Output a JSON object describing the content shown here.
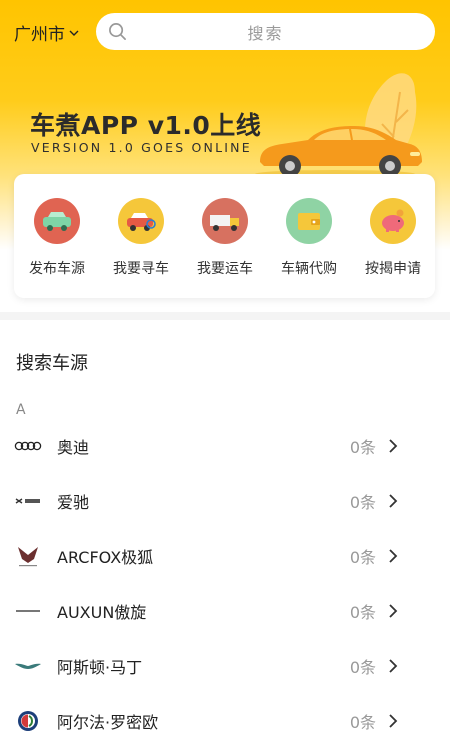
{
  "header": {
    "city": "广州市",
    "search_placeholder": "搜索"
  },
  "banner": {
    "title": "车煮APP v1.0上线",
    "subtitle": "VERSION 1.0 GOES ONLINE"
  },
  "services": [
    {
      "label": "发布车源",
      "icon": "car-icon",
      "color": "#e06452"
    },
    {
      "label": "我要寻车",
      "icon": "car-search-icon",
      "color": "#f5c73a"
    },
    {
      "label": "我要运车",
      "icon": "truck-icon",
      "color": "#d77160"
    },
    {
      "label": "车辆代购",
      "icon": "wallet-icon",
      "color": "#8fd3a4"
    },
    {
      "label": "按揭申请",
      "icon": "piggy-bank-icon",
      "color": "#f5c73a"
    }
  ],
  "brands_section": {
    "title": "搜索车源",
    "letter": "A",
    "items": [
      {
        "name": "奥迪",
        "count": "0条",
        "icon": "audi-logo-icon"
      },
      {
        "name": "爱驰",
        "count": "0条",
        "icon": "aiways-logo-icon"
      },
      {
        "name": "ARCFOX极狐",
        "count": "0条",
        "icon": "arcfox-logo-icon"
      },
      {
        "name": "AUXUN傲旋",
        "count": "0条",
        "icon": "auxun-logo-icon"
      },
      {
        "name": "阿斯顿·马丁",
        "count": "0条",
        "icon": "aston-martin-logo-icon"
      },
      {
        "name": "阿尔法·罗密欧",
        "count": "0条",
        "icon": "alfa-romeo-logo-icon"
      }
    ]
  },
  "colors": {
    "brand_yellow": "#ffc400",
    "text_dark": "#222222",
    "text_muted": "#999999"
  }
}
